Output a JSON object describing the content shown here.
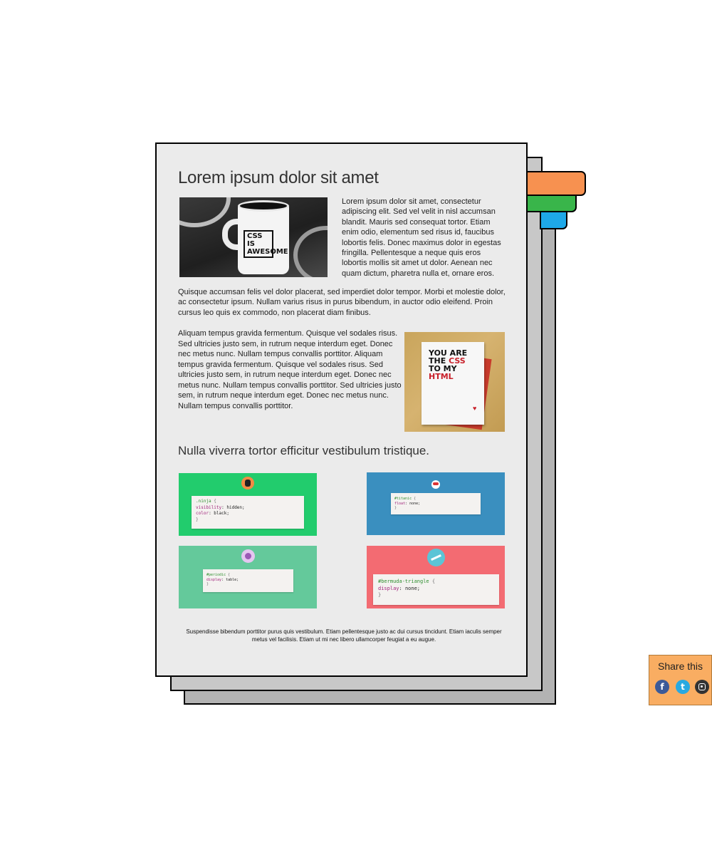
{
  "colors": {
    "tab_orange": "#f79150",
    "tab_green": "#39b54a",
    "tab_blue": "#1ea8e8",
    "tile_ninja": "#22cc6d",
    "tile_titanic": "#3a8fbf",
    "tile_periodic": "#64c99b",
    "tile_bermuda": "#f36b72",
    "share_bg": "#f9ad62"
  },
  "article": {
    "title": "Lorem ipsum dolor sit amet",
    "mug_image": {
      "text_line1": "CSS",
      "text_line2": "IS",
      "text_line3": "AWESOME"
    },
    "paragraph_wrap": "Lorem ipsum dolor sit amet, consectetur adipiscing elit. Sed vel velit in nisl accumsan blandit. Mauris sed consequat tortor. Etiam enim odio, elementum sed risus id, faucibus lobortis felis. Donec maximus dolor in egestas fringilla. Pellentesque a neque quis eros lobortis mollis sit amet ut dolor. Aenean nec quam dictum, pharetra nulla et, ornare eros.",
    "paragraph_full": "Quisque accumsan felis vel dolor placerat, sed imperdiet dolor tempor. Morbi et molestie dolor, ac consectetur ipsum. Nullam varius risus in purus bibendum, in auctor odio eleifend. Proin cursus leo quis ex commodo, non placerat diam finibus.",
    "paragraph_left": "Aliquam tempus gravida fermentum. Quisque vel sodales risus. Sed ultricies justo sem, in rutrum neque interdum eget. Donec nec metus nunc. Nullam tempus convallis porttitor. Aliquam tempus gravida fermentum. Quisque vel sodales risus. Sed ultricies justo sem, in rutrum neque interdum eget. Donec nec metus nunc. Nullam tempus convallis porttitor. Sed ultricies justo sem, in rutrum neque interdum eget. Donec nec metus nunc. Nullam tempus convallis porttitor.",
    "card_image": {
      "line1": "YOU ARE",
      "line2_a": "THE ",
      "line2_b": "CSS",
      "line3": "TO MY",
      "line4": "HTML",
      "heart": "♥"
    },
    "section_title": "Nulla viverra tortor efficitur vestibulum tristique.",
    "tiles": [
      {
        "selector": ".ninja",
        "lines": [
          {
            "prop": "visibility",
            "value": " hidden;"
          },
          {
            "prop": "color",
            "value": " black;"
          }
        ]
      },
      {
        "selector": "#titanic",
        "lines": [
          {
            "prop": "float",
            "value": " none;"
          }
        ]
      },
      {
        "selector": "#periodic",
        "lines": [
          {
            "prop": "display",
            "value": " table;"
          }
        ]
      },
      {
        "selector": "#bermuda-triangle",
        "lines": [
          {
            "prop": "display",
            "value": " none;"
          }
        ]
      }
    ],
    "footer": "Suspendisse bibendum porttitor purus quis vestibulum. Etiam pellentesque justo ac dui cursus tincidunt. Etiam iaculis semper metus vel facilisis. Etiam ut mi nec libero ullamcorper feugiat a eu augue."
  },
  "share": {
    "label": "Share this",
    "icons": [
      "facebook-icon",
      "twitter-icon",
      "instagram-icon"
    ],
    "facebook_glyph": "f",
    "twitter_glyph": "t"
  }
}
